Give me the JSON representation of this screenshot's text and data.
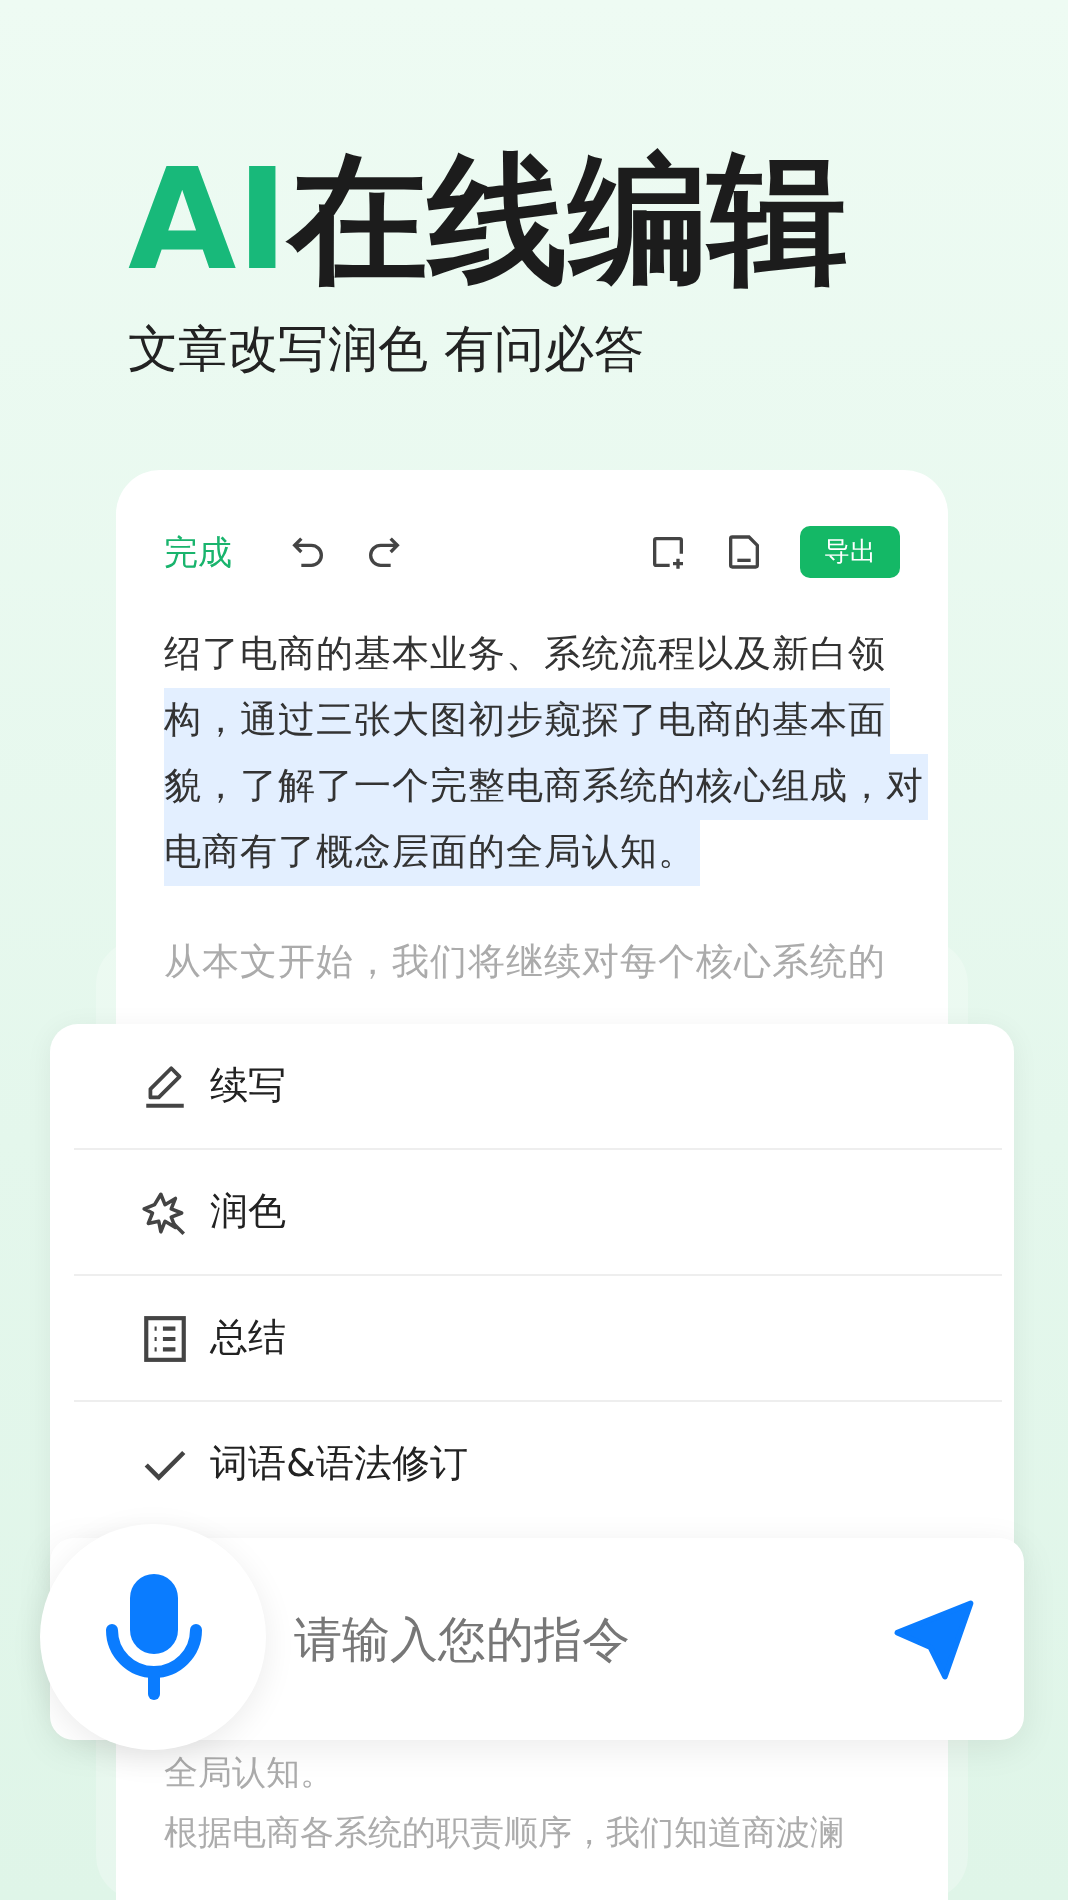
{
  "header": {
    "title_accent": "AI",
    "title": "在线编辑",
    "subtitle": "文章改写润色 有问必答"
  },
  "editor": {
    "done": "完成",
    "export": "导出",
    "lines": [
      {
        "text": "绍了电商的基本业务、系统流程以及新白领",
        "highlighted": false
      },
      {
        "text": "构，通过三张大图初步窥探了电商的基本面",
        "highlighted": true
      },
      {
        "text": "貌，了解了一个完整电商系统的核心组成，对",
        "highlighted": true
      },
      {
        "text": "电商有了概念层面的全局认知。",
        "highlighted": true
      }
    ],
    "faded_line": "从本文开始，我们将继续对每个核心系统的",
    "bottom_lines": [
      "全局认知。",
      "根据电商各系统的职责顺序，我们知道商波澜"
    ]
  },
  "menu": [
    {
      "kind": "pencil",
      "label": "续写"
    },
    {
      "kind": "sparkle",
      "label": "润色"
    },
    {
      "kind": "list",
      "label": "总结"
    },
    {
      "kind": "check",
      "label": "词语&语法修订"
    }
  ],
  "input": {
    "placeholder": "请输入您的指令"
  }
}
